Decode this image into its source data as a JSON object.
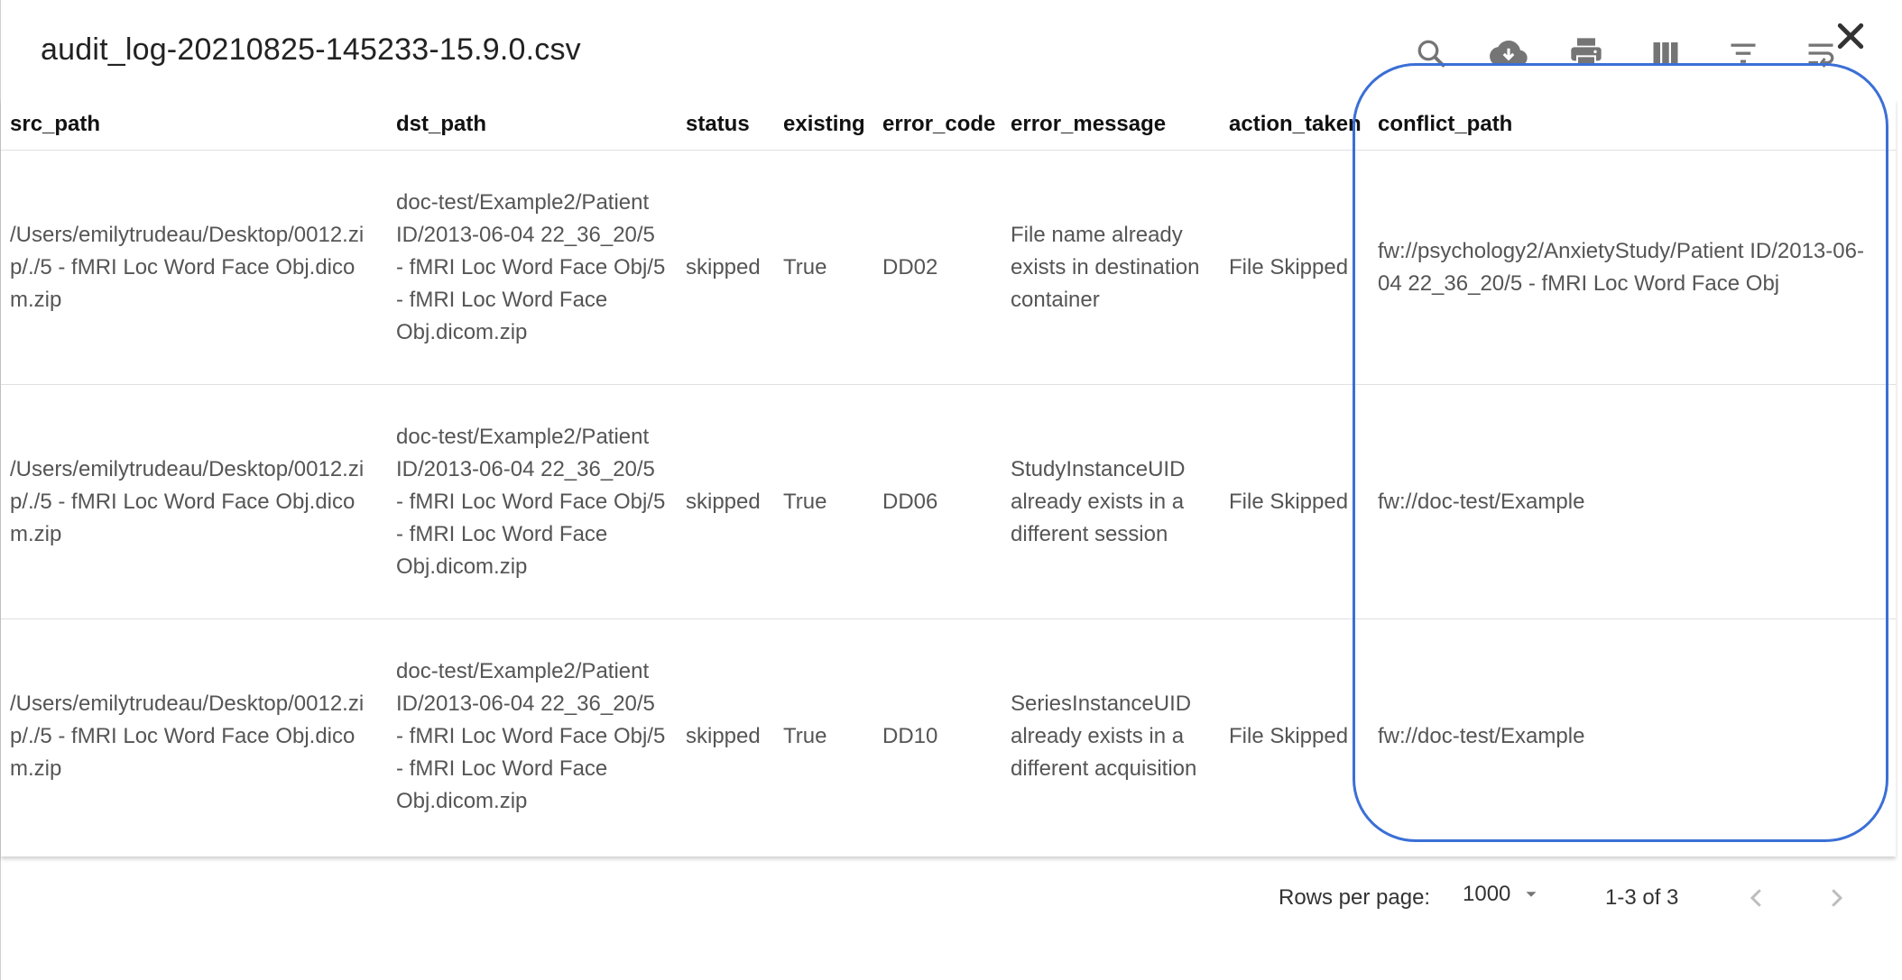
{
  "header": {
    "title": "audit_log-20210825-145233-15.9.0.csv"
  },
  "toolbar": {
    "icons": [
      "search-icon",
      "cloud-download-icon",
      "print-icon",
      "view-column-icon",
      "filter-icon",
      "wrap-text-icon",
      "close-icon"
    ]
  },
  "table": {
    "columns": [
      "src_path",
      "dst_path",
      "status",
      "existing",
      "error_code",
      "error_message",
      "action_taken",
      "conflict_path"
    ],
    "rows": [
      {
        "src_path": "/Users/emilytrudeau/Desktop/0012.zip/./5 - fMRI Loc Word Face Obj.dicom.zip",
        "dst_path": "doc-test/Example2/Patient ID/2013-06-04 22_36_20/5 - fMRI Loc Word Face Obj/5 - fMRI Loc Word Face Obj.dicom.zip",
        "status": "skipped",
        "existing": "True",
        "error_code": "DD02",
        "error_message": "File name already exists in destination container",
        "action_taken": "File Skipped",
        "conflict_path": "fw://psychology2/AnxietyStudy/Patient ID/2013-06-04 22_36_20/5 - fMRI Loc Word Face Obj"
      },
      {
        "src_path": "/Users/emilytrudeau/Desktop/0012.zip/./5 - fMRI Loc Word Face Obj.dicom.zip",
        "dst_path": "doc-test/Example2/Patient ID/2013-06-04 22_36_20/5 - fMRI Loc Word Face Obj/5 - fMRI Loc Word Face Obj.dicom.zip",
        "status": "skipped",
        "existing": "True",
        "error_code": "DD06",
        "error_message": "StudyInstanceUID already exists in a different session",
        "action_taken": "File Skipped",
        "conflict_path": "fw://doc-test/Example"
      },
      {
        "src_path": "/Users/emilytrudeau/Desktop/0012.zip/./5 - fMRI Loc Word Face Obj.dicom.zip",
        "dst_path": "doc-test/Example2/Patient ID/2013-06-04 22_36_20/5 - fMRI Loc Word Face Obj/5 - fMRI Loc Word Face Obj.dicom.zip",
        "status": "skipped",
        "existing": "True",
        "error_code": "DD10",
        "error_message": "SeriesInstanceUID already exists in a different acquisition",
        "action_taken": "File Skipped",
        "conflict_path": "fw://doc-test/Example"
      }
    ]
  },
  "footer": {
    "rows_per_page_label": "Rows per page:",
    "rows_per_page_value": "1000",
    "page_info": "1-3 of 3"
  },
  "colors": {
    "highlight": "#3b6fd6",
    "icon": "#757575",
    "disabled": "#bdbdbd"
  }
}
